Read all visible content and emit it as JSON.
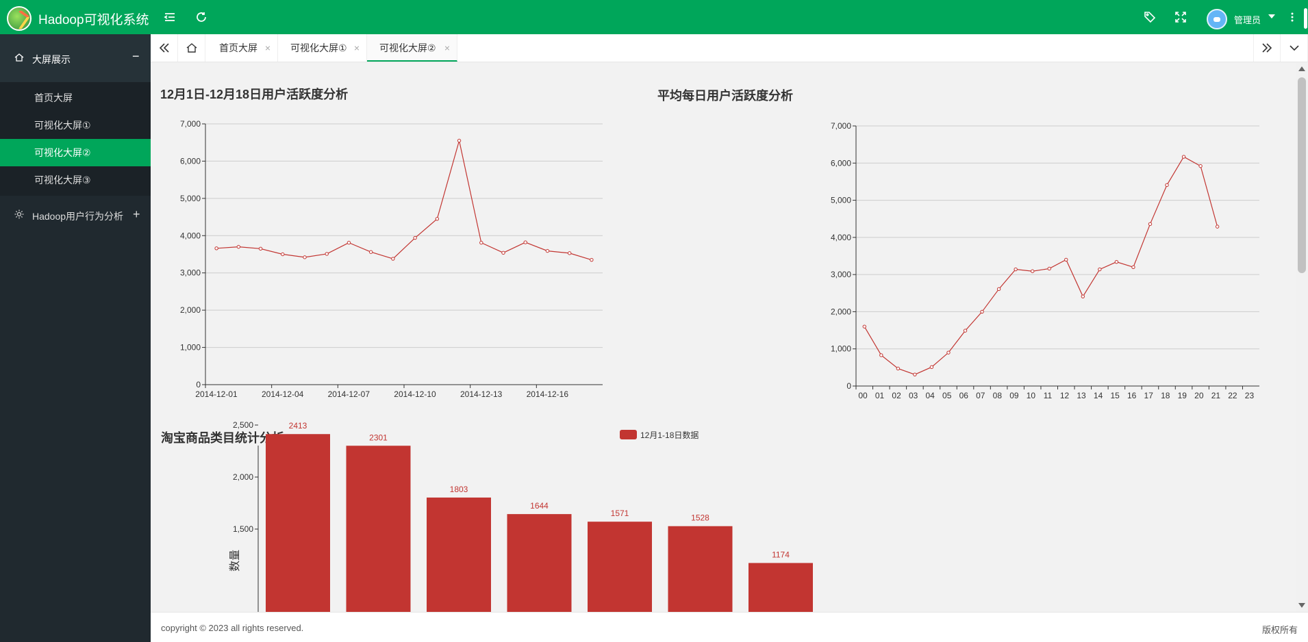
{
  "header": {
    "title": "Hadoop可视化系统",
    "user_name": "管理员",
    "icons": [
      "menu-fold-icon",
      "refresh-icon",
      "tag-icon",
      "fullscreen-icon",
      "avatar",
      "more-icon"
    ]
  },
  "sidebar": {
    "group1": {
      "label": "大屏展示",
      "toggle": "−",
      "icon": "home-icon"
    },
    "items": [
      {
        "label": "首页大屏"
      },
      {
        "label": "可视化大屏①"
      },
      {
        "label": "可视化大屏②"
      },
      {
        "label": "可视化大屏③"
      }
    ],
    "active_item": 2,
    "group2": {
      "label": "Hadoop用户行为分析",
      "toggle": "+",
      "icon": "gear-icon"
    }
  },
  "tabs": {
    "items": [
      {
        "label": "首页大屏",
        "close": "×"
      },
      {
        "label": "可视化大屏①",
        "close": "×"
      },
      {
        "label": "可视化大屏②",
        "close": "×"
      }
    ],
    "active": 2
  },
  "footer": {
    "copyright": "copyright © 2023 all rights reserved.",
    "rights": "版权所有"
  },
  "colors": {
    "brand": "#00a65a",
    "series": "#c23531",
    "sidebar": "#20292f"
  },
  "chart_data": [
    {
      "type": "line",
      "title": "12月1日-12月18日用户活跃度分析",
      "x": [
        "2014-12-01",
        "2014-12-02",
        "2014-12-03",
        "2014-12-04",
        "2014-12-05",
        "2014-12-06",
        "2014-12-07",
        "2014-12-08",
        "2014-12-09",
        "2014-12-10",
        "2014-12-11",
        "2014-12-12",
        "2014-12-13",
        "2014-12-14",
        "2014-12-15",
        "2014-12-16",
        "2014-12-17",
        "2014-12-18"
      ],
      "xticks": [
        "2014-12-01",
        "2014-12-04",
        "2014-12-07",
        "2014-12-10",
        "2014-12-13",
        "2014-12-16"
      ],
      "values": [
        3660,
        3700,
        3650,
        3500,
        3420,
        3510,
        3810,
        3560,
        3380,
        3940,
        4450,
        6550,
        3810,
        3540,
        3820,
        3590,
        3530,
        3350
      ],
      "ylim": [
        0,
        7000
      ],
      "yticks": [
        "0",
        "1,000",
        "2,000",
        "3,000",
        "4,000",
        "5,000",
        "6,000",
        "7,000"
      ],
      "grid": true
    },
    {
      "type": "line",
      "title": "平均每日用户活跃度分析",
      "x": [
        "00",
        "01",
        "02",
        "03",
        "04",
        "05",
        "06",
        "07",
        "08",
        "09",
        "10",
        "11",
        "12",
        "13",
        "14",
        "15",
        "16",
        "17",
        "18",
        "19",
        "20",
        "21",
        "22",
        "23"
      ],
      "values": [
        1600,
        830,
        470,
        310,
        510,
        900,
        1490,
        2000,
        2610,
        3140,
        3090,
        3160,
        3400,
        2410,
        3140,
        3340,
        3200,
        4360,
        5410,
        6170,
        5920,
        4290,
        null,
        null
      ],
      "ylim": [
        0,
        7000
      ],
      "yticks": [
        "0",
        "1,000",
        "2,000",
        "3,000",
        "4,000",
        "5,000",
        "6,000",
        "7,000"
      ],
      "grid": true
    },
    {
      "type": "bar",
      "title": "淘宝商品类目统计分析",
      "series": [
        {
          "name": "12月1-18日数据",
          "values": [
            2413,
            2301,
            1803,
            1644,
            1571,
            1528,
            1174
          ]
        }
      ],
      "value_labels": [
        "2413",
        "2301",
        "1803",
        "1644",
        "1571",
        "1528",
        "1174"
      ],
      "ylabel": "数量",
      "yticks": [
        "1,500",
        "2,000",
        "2,500"
      ],
      "legend": "top"
    }
  ]
}
